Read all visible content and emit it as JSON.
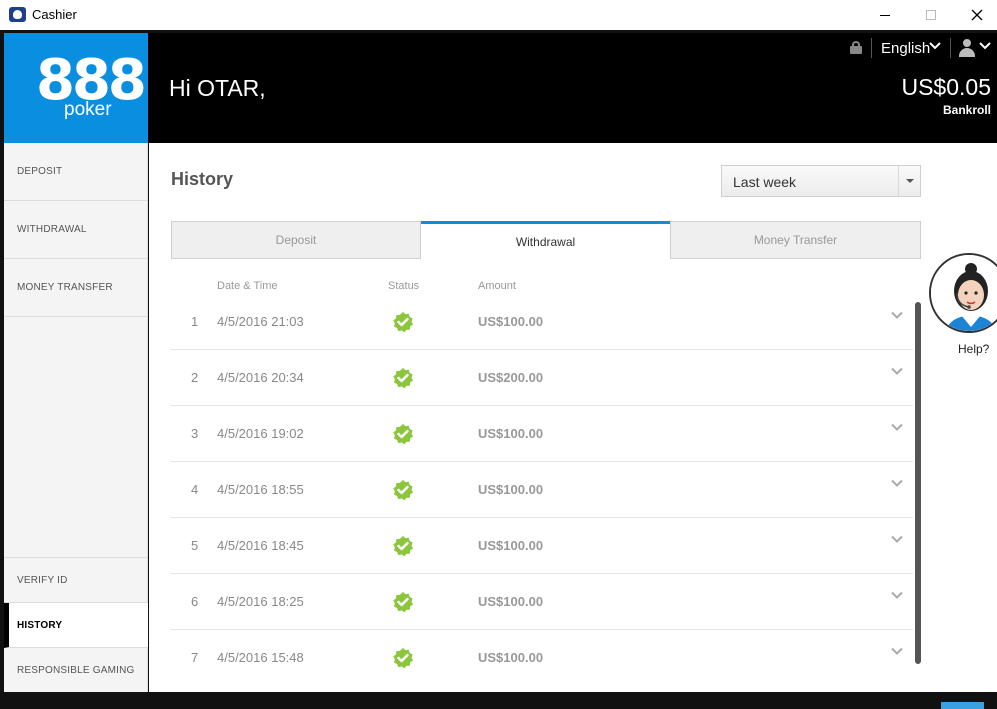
{
  "window": {
    "title": "Cashier",
    "icon": "cashier-app-icon"
  },
  "header": {
    "logo_number": "888",
    "logo_text": "poker",
    "greeting": "Hi OTAR,",
    "language": "English",
    "balance": "US$0.05",
    "balance_label": "Bankroll",
    "icons": [
      "lock-icon",
      "chevron-down-icon",
      "user-icon"
    ]
  },
  "sidebar": {
    "items": [
      {
        "label": "DEPOSIT",
        "active": false
      },
      {
        "label": "WITHDRAWAL",
        "active": false
      },
      {
        "label": "MONEY TRANSFER",
        "active": false
      },
      {
        "label": "VERIFY ID",
        "active": false
      },
      {
        "label": "HISTORY",
        "active": true
      },
      {
        "label": "RESPONSIBLE GAMING",
        "active": false
      }
    ]
  },
  "main": {
    "title": "History",
    "period": "Last week",
    "tabs": [
      {
        "label": "Deposit",
        "active": false
      },
      {
        "label": "Withdrawal",
        "active": true
      },
      {
        "label": "Money Transfer",
        "active": false
      }
    ],
    "columns": {
      "date": "Date & Time",
      "status": "Status",
      "amount": "Amount"
    },
    "rows": [
      {
        "num": "1",
        "date": "4/5/2016 21:03",
        "status": "completed",
        "amount": "US$100.00"
      },
      {
        "num": "2",
        "date": "4/5/2016 20:34",
        "status": "completed",
        "amount": "US$200.00"
      },
      {
        "num": "3",
        "date": "4/5/2016 19:02",
        "status": "completed",
        "amount": "US$100.00"
      },
      {
        "num": "4",
        "date": "4/5/2016 18:55",
        "status": "completed",
        "amount": "US$100.00"
      },
      {
        "num": "5",
        "date": "4/5/2016 18:45",
        "status": "completed",
        "amount": "US$100.00"
      },
      {
        "num": "6",
        "date": "4/5/2016 18:25",
        "status": "completed",
        "amount": "US$100.00"
      },
      {
        "num": "7",
        "date": "4/5/2016 15:48",
        "status": "completed",
        "amount": "US$100.00"
      }
    ]
  },
  "help": {
    "label": "Help?"
  },
  "colors": {
    "brand": "#0a8fe0",
    "header_bg": "#000000",
    "success": "#8cc63f"
  }
}
